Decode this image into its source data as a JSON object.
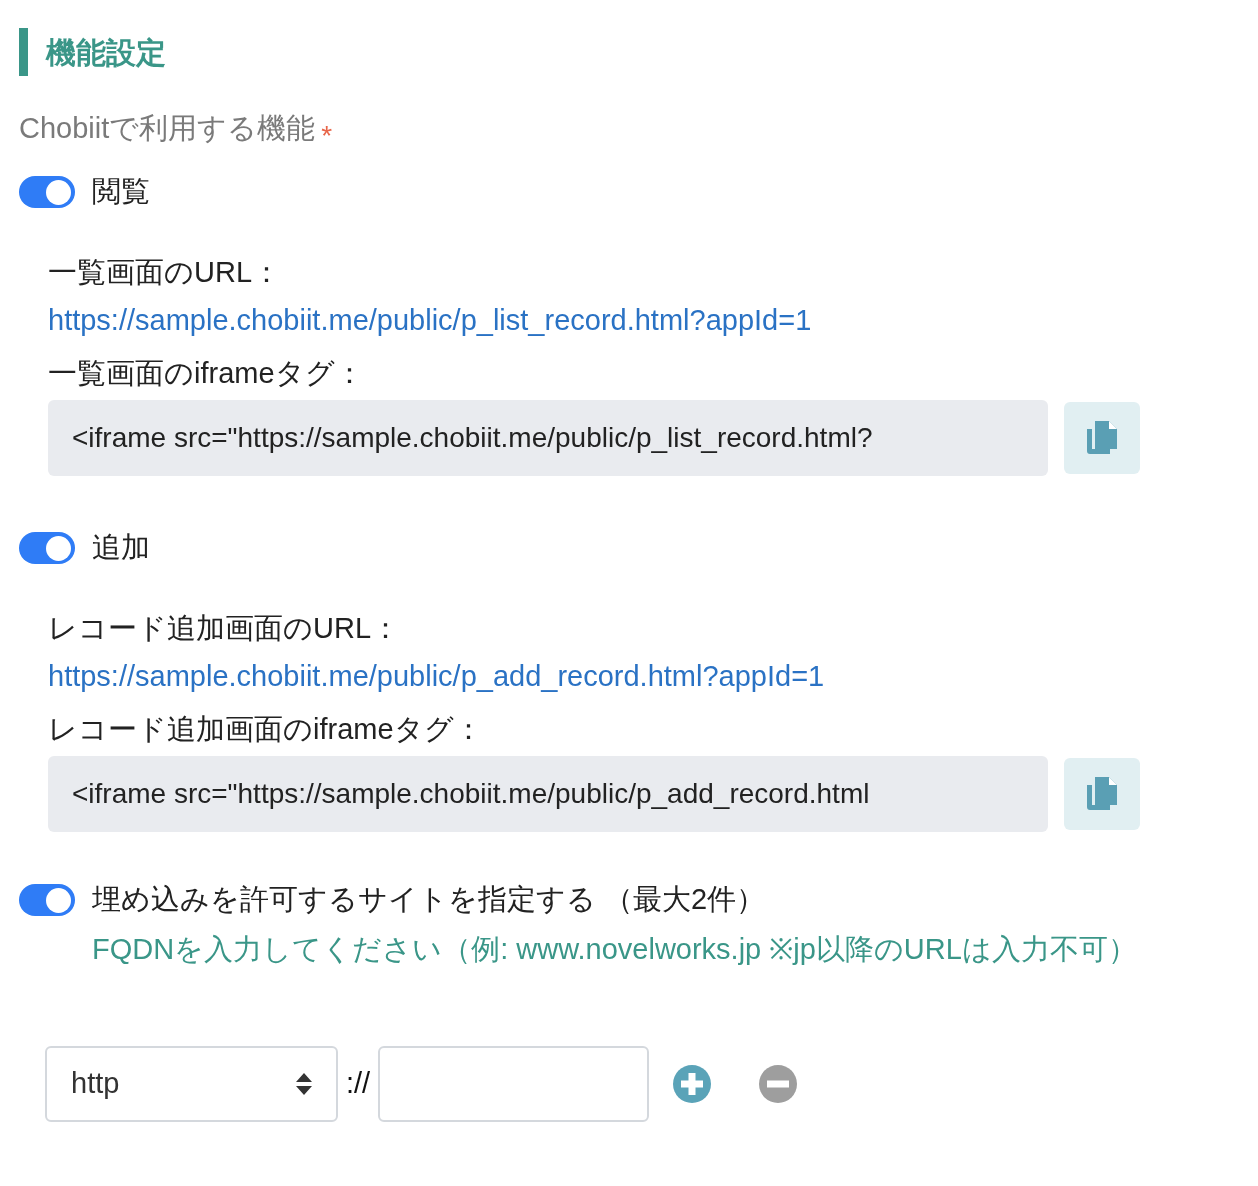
{
  "section_title": "機能設定",
  "field_label": "Chobiitで利用する機能",
  "required_mark": "*",
  "features": [
    {
      "label": "閲覧",
      "on": true,
      "url_label": "一覧画面のURL：",
      "url": "https://sample.chobiit.me/public/p_list_record.html?appId=1",
      "iframe_label": "一覧画面のiframeタグ：",
      "iframe_value": "<iframe src=\"https://sample.chobiit.me/public/p_list_record.html?"
    },
    {
      "label": "追加",
      "on": true,
      "url_label": "レコード追加画面のURL：",
      "url": "https://sample.chobiit.me/public/p_add_record.html?appId=1",
      "iframe_label": "レコード追加画面のiframeタグ：",
      "iframe_value": "<iframe src=\"https://sample.chobiit.me/public/p_add_record.html"
    }
  ],
  "embed": {
    "label": "埋め込みを許可するサイトを指定する （最大2件）",
    "on": true,
    "hint": "FQDNを入力してください（例: www.novelworks.jp ※jp以降のURLは入力不可）",
    "rows": [
      {
        "scheme": "http",
        "separator": "://"
      }
    ]
  }
}
